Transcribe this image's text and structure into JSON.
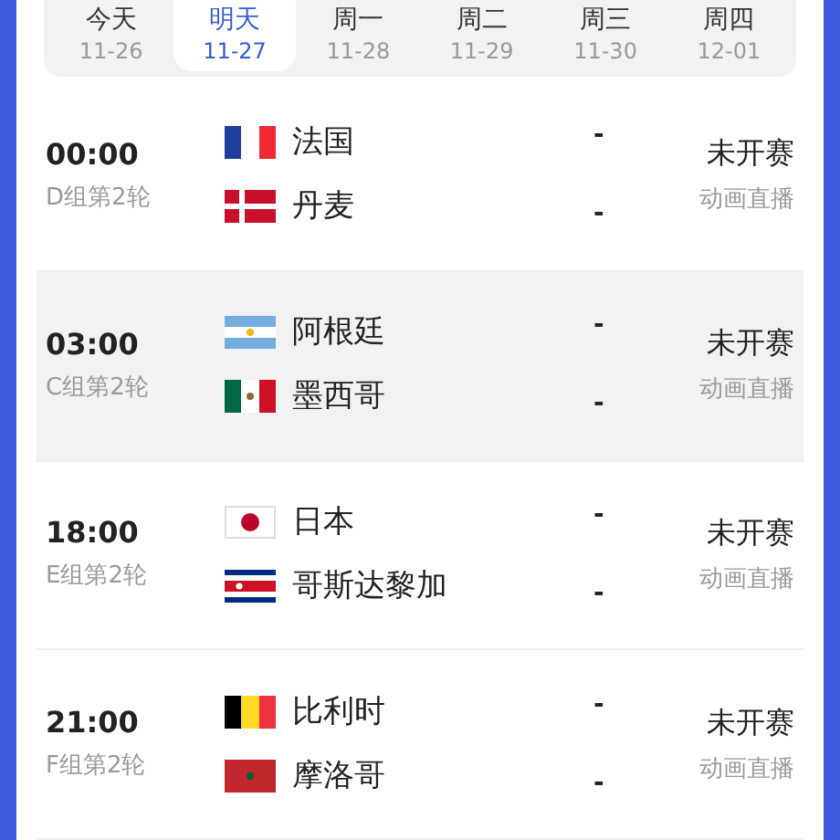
{
  "date_tabs": [
    {
      "label": "今天",
      "date": "11-26",
      "selected": false
    },
    {
      "label": "明天",
      "date": "11-27",
      "selected": true
    },
    {
      "label": "周一",
      "date": "11-28",
      "selected": false
    },
    {
      "label": "周二",
      "date": "11-29",
      "selected": false
    },
    {
      "label": "周三",
      "date": "11-30",
      "selected": false
    },
    {
      "label": "周四",
      "date": "12-01",
      "selected": false
    }
  ],
  "matches": [
    {
      "time": "00:00",
      "round": "D组第2轮",
      "highlighted": false,
      "status": "未开赛",
      "broadcast": "动画直播",
      "teams": [
        {
          "kind": "france",
          "name": "法国",
          "score": "-"
        },
        {
          "kind": "denmark",
          "name": "丹麦",
          "score": "-"
        }
      ]
    },
    {
      "time": "03:00",
      "round": "C组第2轮",
      "highlighted": true,
      "status": "未开赛",
      "broadcast": "动画直播",
      "teams": [
        {
          "kind": "argentina",
          "name": "阿根廷",
          "score": "-"
        },
        {
          "kind": "mexico",
          "name": "墨西哥",
          "score": "-"
        }
      ]
    },
    {
      "time": "18:00",
      "round": "E组第2轮",
      "highlighted": false,
      "status": "未开赛",
      "broadcast": "动画直播",
      "teams": [
        {
          "kind": "japan",
          "name": "日本",
          "score": "-"
        },
        {
          "kind": "costa_rica",
          "name": "哥斯达黎加",
          "score": "-"
        }
      ]
    },
    {
      "time": "21:00",
      "round": "F组第2轮",
      "highlighted": false,
      "status": "未开赛",
      "broadcast": "动画直播",
      "teams": [
        {
          "kind": "belgium",
          "name": "比利时",
          "score": "-"
        },
        {
          "kind": "morocco",
          "name": "摩洛哥",
          "score": "-"
        }
      ]
    }
  ]
}
